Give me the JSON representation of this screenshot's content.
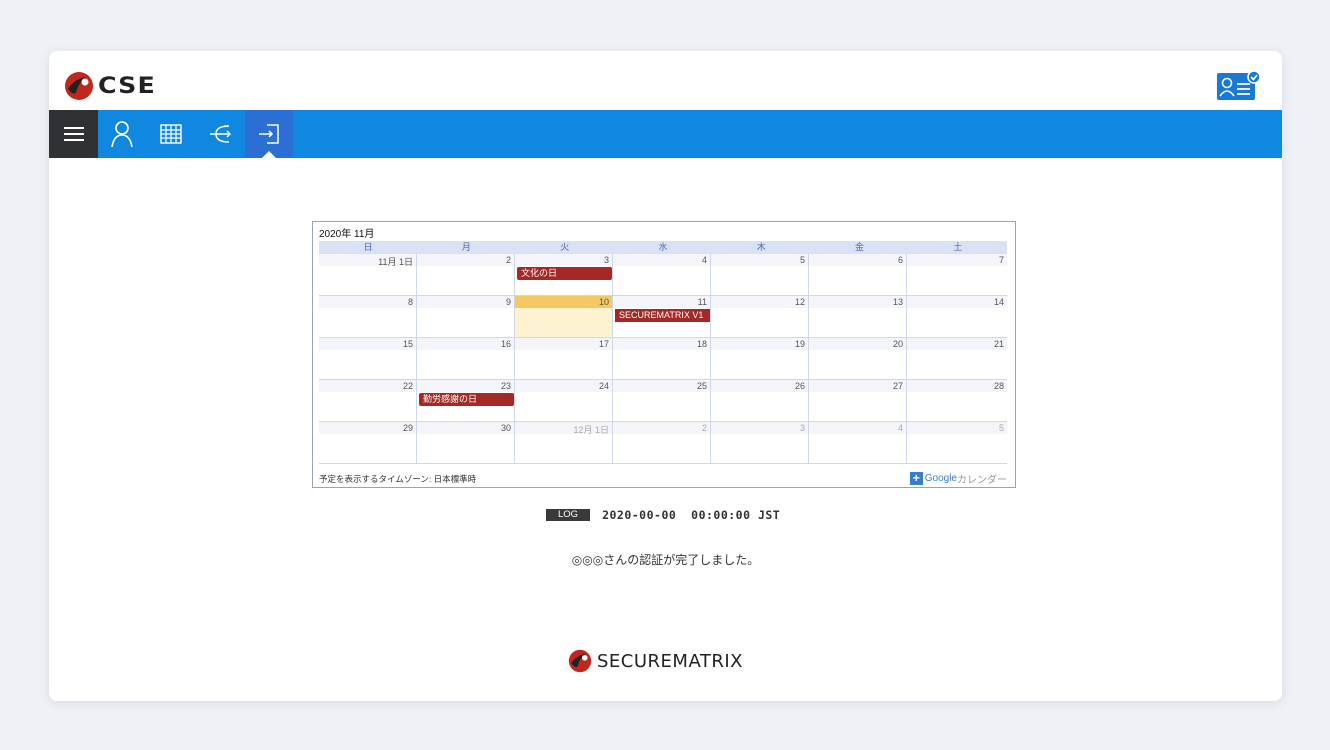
{
  "header": {
    "brand": "CSE",
    "profile_icon": "user-verified-icon"
  },
  "nav": {
    "items": [
      {
        "icon": "menu-icon"
      },
      {
        "icon": "user-icon"
      },
      {
        "icon": "grid-icon"
      },
      {
        "icon": "tree-icon"
      },
      {
        "icon": "login-icon"
      }
    ],
    "accent": "#1088e0",
    "active": "#2b6fd4"
  },
  "calendar": {
    "title": "2020年 11月",
    "days_of_week": [
      "日",
      "月",
      "火",
      "水",
      "木",
      "金",
      "土"
    ],
    "weeks": [
      {
        "days": [
          "11月 1日",
          "2",
          "3",
          "4",
          "5",
          "6",
          "7"
        ]
      },
      {
        "days": [
          "8",
          "9",
          "10",
          "11",
          "12",
          "13",
          "14"
        ]
      },
      {
        "days": [
          "15",
          "16",
          "17",
          "18",
          "19",
          "20",
          "21"
        ]
      },
      {
        "days": [
          "22",
          "23",
          "24",
          "25",
          "26",
          "27",
          "28"
        ]
      },
      {
        "days": [
          "29",
          "30",
          "12月 1日",
          "2",
          "3",
          "4",
          "5"
        ]
      }
    ],
    "events": {
      "culture_day": "文化の日",
      "securematrix": "SECUREMATRIX V1",
      "labor_day": "勤労感謝の日"
    },
    "timezone_note": "予定を表示するタイムゾーン: 日本標準時",
    "google_plus": "+",
    "google_word": "Google",
    "google_suffix": "カレンダー"
  },
  "log": {
    "badge": "LOG",
    "timestamp": "2020-00-00  00:00:00 JST"
  },
  "message": "◎◎◎さんの認証が完了しました。",
  "footer": {
    "logo_text": "SECUREMATRIX"
  }
}
